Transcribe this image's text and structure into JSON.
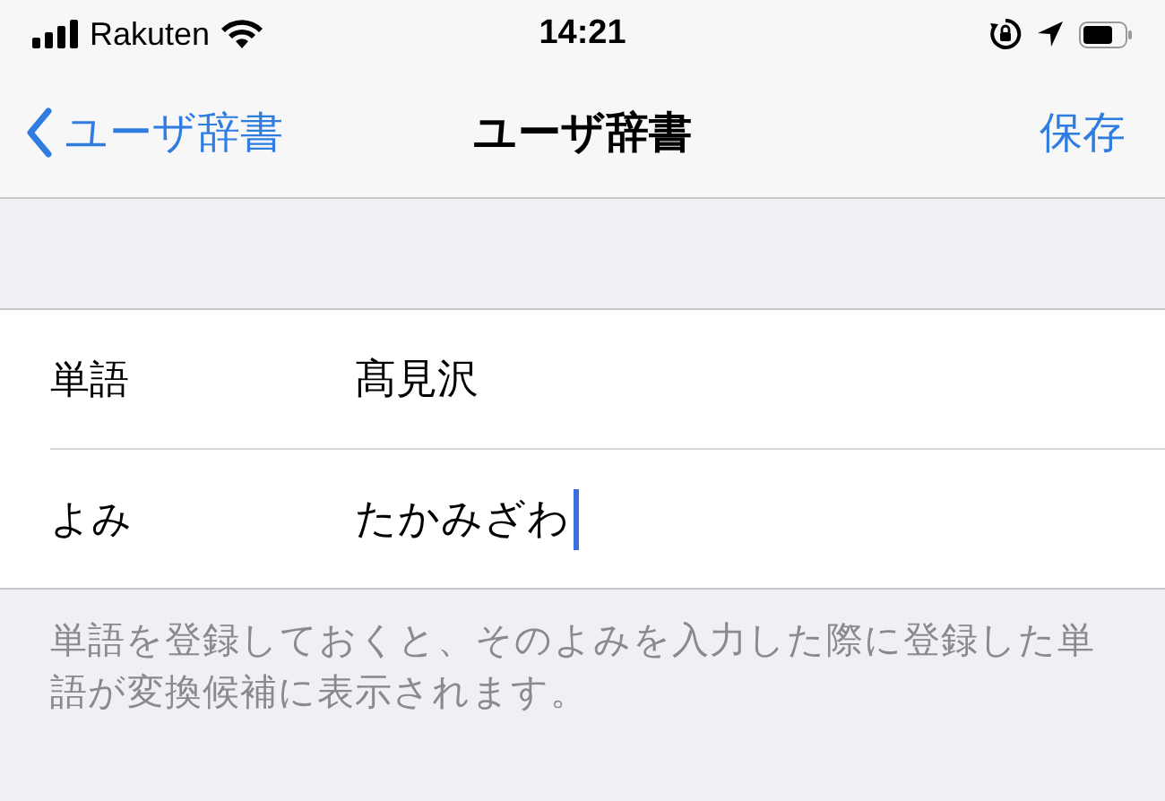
{
  "status_bar": {
    "carrier": "Rakuten",
    "time": "14:21"
  },
  "nav": {
    "back": "ユーザ辞書",
    "title": "ユーザ辞書",
    "action": "保存"
  },
  "fields": [
    {
      "label": "単語",
      "value": "髙見沢",
      "focused": false
    },
    {
      "label": "よみ",
      "value": "たかみざわ",
      "focused": true
    }
  ],
  "footer": "単語を登録しておくと、そのよみを入力した際に登録した単語が変換候補に表示されます。"
}
